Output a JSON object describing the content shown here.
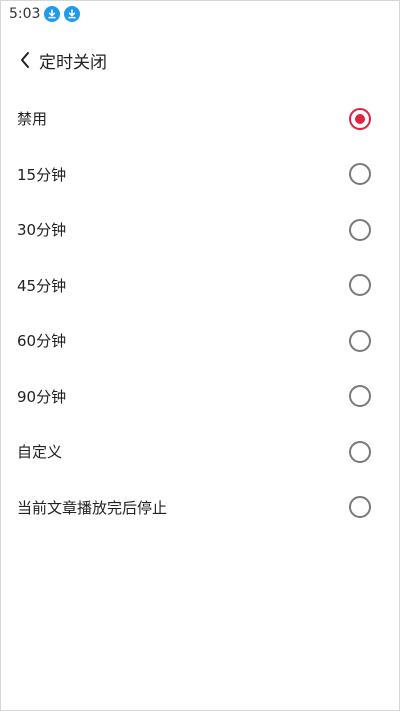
{
  "status_bar": {
    "time": "5:03",
    "icons": [
      "download-icon",
      "download-icon"
    ],
    "icon_color": "#1e9bea"
  },
  "header": {
    "back_icon": "chevron-left-icon",
    "title": "定时关闭"
  },
  "accent_color": "#e0243f",
  "options": [
    {
      "label": "禁用",
      "selected": true
    },
    {
      "label": "15分钟",
      "selected": false
    },
    {
      "label": "30分钟",
      "selected": false
    },
    {
      "label": "45分钟",
      "selected": false
    },
    {
      "label": "60分钟",
      "selected": false
    },
    {
      "label": "90分钟",
      "selected": false
    },
    {
      "label": "自定义",
      "selected": false
    },
    {
      "label": "当前文章播放完后停止",
      "selected": false
    }
  ]
}
